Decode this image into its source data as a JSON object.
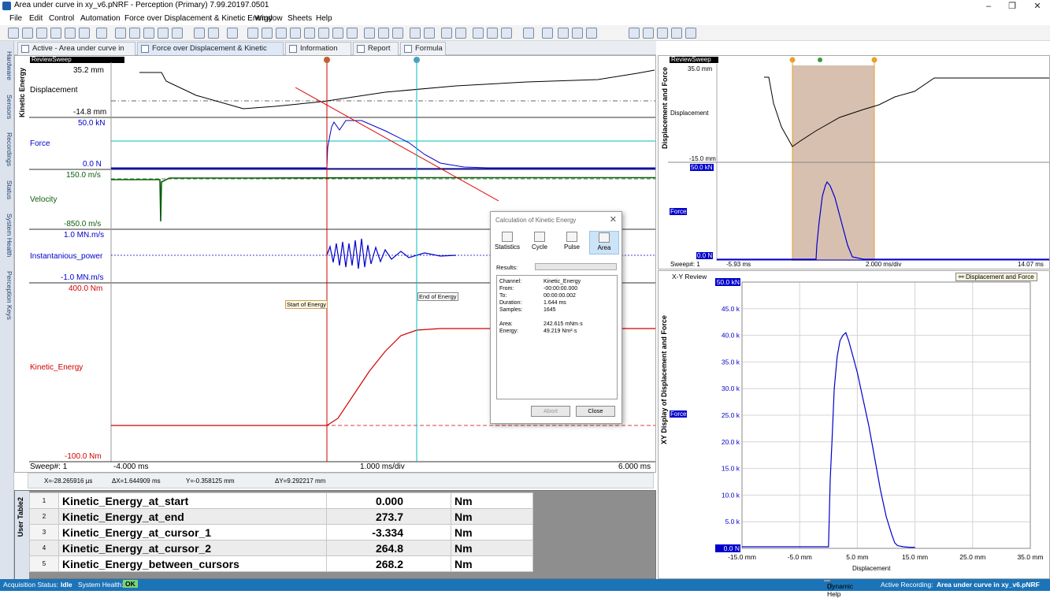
{
  "window": {
    "title": "Area under curve in xy_v6.pNRF - Perception (Primary) 7.99.20197.0501",
    "minimize": "–",
    "maximize": "❐",
    "close": "✕"
  },
  "menu": [
    "File",
    "Edit",
    "Control",
    "Automation",
    "Force over Displacement & Kinetic Energy",
    "Window",
    "Sheets",
    "Help"
  ],
  "left_sidebar": [
    "Hardware",
    "Sensors",
    "Recordings",
    "Status",
    "System Health",
    "Perception Keys"
  ],
  "tabs": [
    {
      "label": "Active - Area under curve in xy_v6"
    },
    {
      "label": "Force over Displacement & Kinetic Energy"
    },
    {
      "label": "Information"
    },
    {
      "label": "Report"
    },
    {
      "label": "Formula"
    }
  ],
  "left_view": {
    "header": "ReviewSweep",
    "side_label": "Kinetic Energy",
    "channels": [
      {
        "name": "Displacement",
        "max": "35.2 mm",
        "min": "-14.8 mm"
      },
      {
        "name": "Force",
        "max": "50.0 kN",
        "min": "0.0  N"
      },
      {
        "name": "Velocity",
        "max": "150.0  m/s",
        "min": "-850.0  m/s"
      },
      {
        "name": "Instantanious_power",
        "max": "1.0 MN.m/s",
        "min": "-1.0 MN.m/s"
      },
      {
        "name": "Kinetic_Energy",
        "max": "400.0  Nm",
        "min": "-100.0  Nm"
      }
    ],
    "annotations": {
      "start": "Start of Energy",
      "end": "End of Energy"
    },
    "sweep": "Sweep#: 1",
    "x_start": "-4.000 ms",
    "x_div": "1.000 ms/div",
    "x_end": "6.000 ms",
    "cursor_readout": {
      "x": "X=-28.265916 µs",
      "dx": "ΔX=1.644909 ms",
      "y": "Y=-0.358125 mm",
      "dy": "ΔY=9.292217 mm"
    }
  },
  "dialog": {
    "title": "Calculation of Kinetic Energy",
    "close": "✕",
    "tools": [
      "Statistics",
      "Cycle",
      "Pulse",
      "Area"
    ],
    "results_label": "Results:",
    "results": [
      {
        "k": "Channel:",
        "v": "Kinetic_Energy"
      },
      {
        "k": "From:",
        "v": "-00:00:00.000"
      },
      {
        "k": "To:",
        "v": "00:00:00.002"
      },
      {
        "k": "Duration:",
        "v": "1.644 ms"
      },
      {
        "k": "Samples:",
        "v": "1645"
      },
      {
        "k": "Area:",
        "v": "242.615 mNm·s"
      },
      {
        "k": "Energy:",
        "v": "49.219  Nm²·s"
      }
    ],
    "abort": "Abort",
    "close_button": "Close"
  },
  "user_table": {
    "title": "User Table2",
    "rows": [
      {
        "idx": "1",
        "name": "Kinetic_Energy_at_start",
        "value": "0.000",
        "unit": "Nm"
      },
      {
        "idx": "2",
        "name": "Kinetic_Energy_at_end",
        "value": "273.7",
        "unit": "Nm"
      },
      {
        "idx": "3",
        "name": "Kinetic_Energy_at_cursor_1",
        "value": "-3.334",
        "unit": "Nm"
      },
      {
        "idx": "4",
        "name": "Kinetic_Energy_at_cursor_2",
        "value": "264.8",
        "unit": "Nm"
      },
      {
        "idx": "5",
        "name": "Kinetic_Energy_between_cursors",
        "value": "268.2",
        "unit": "Nm"
      }
    ]
  },
  "right_top": {
    "header": "ReviewSweep",
    "side_label": "Displacement and Force",
    "disp": {
      "name": "Displacement",
      "max": "35.0 mm",
      "min": "-15.0 mm"
    },
    "force": {
      "name": "Force",
      "max": "50.0 kN",
      "min": "0.0  N"
    },
    "sweep": "Sweep#: 1",
    "x_start": "-5.93 ms",
    "x_div": "2.000 ms/div",
    "x_end": "14.07 ms"
  },
  "right_bottom": {
    "title": "X-Y Review",
    "side_label": "XY Display of Displacement and Force",
    "legend": "Displacement and Force",
    "y_channel": "Force",
    "x_label": "Displacement"
  },
  "xy_chart": {
    "type": "line",
    "y_ticks": [
      "50.0 kN",
      "45.0 k",
      "40.0 k",
      "35.0 k",
      "30.0 k",
      "25.0 k",
      "20.0 k",
      "15.0 k",
      "10.0 k",
      "5.0 k",
      "0.0 N"
    ],
    "x_ticks": [
      "-15.0 mm",
      "-5.0 mm",
      "5.0 mm",
      "15.0 mm",
      "25.0 mm",
      "35.0 mm"
    ],
    "xlim": [
      -15,
      35
    ],
    "ylim": [
      0,
      50
    ],
    "series": [
      {
        "x": [
          -15,
          -5,
          0,
          0.3,
          0.6,
          1,
          1.5,
          2,
          2.5,
          3,
          3.5,
          4,
          5,
          6,
          7,
          8,
          9,
          10,
          11,
          11.5,
          12,
          13,
          14,
          15
        ],
        "y": [
          0.3,
          0.3,
          0.3,
          13,
          20,
          30,
          36,
          39,
          40,
          40.5,
          39,
          37,
          33,
          28,
          23,
          17,
          11,
          6,
          2.5,
          1,
          0.5,
          0.3,
          0.2,
          0.2
        ]
      }
    ]
  },
  "status": {
    "acq_label": "Acquisition Status:",
    "acq_value": "Idle",
    "health_label": "System Health:",
    "health_value": "OK",
    "dynamic_help": "Dynamic Help",
    "recording_label": "Active Recording:",
    "recording_value": "Area under curve in xy_v6.pNRF"
  },
  "colors": {
    "accent": "#1c74b8",
    "force": "#0000cc",
    "velocity": "#0b5e0b",
    "energy": "#d00000",
    "area_fill": "#d8c0b0"
  }
}
